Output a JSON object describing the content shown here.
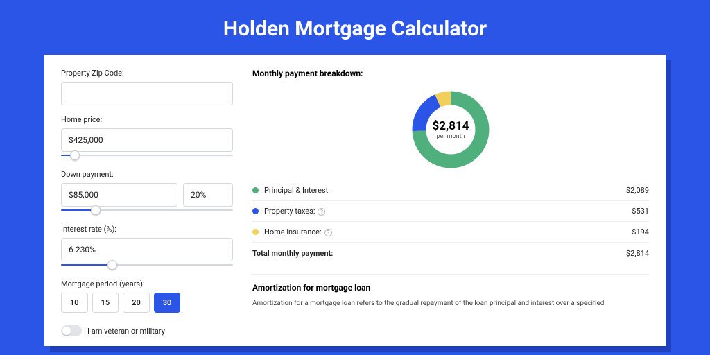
{
  "title": "Holden Mortgage Calculator",
  "form": {
    "zip": {
      "label": "Property Zip Code:",
      "value": ""
    },
    "homePrice": {
      "label": "Home price:",
      "value": "$425,000",
      "sliderPct": 8
    },
    "downPayment": {
      "label": "Down payment:",
      "amount": "$85,000",
      "pct": "20%",
      "sliderPct": 20
    },
    "interest": {
      "label": "Interest rate (%):",
      "value": "6.230%",
      "sliderPct": 30
    },
    "period": {
      "label": "Mortgage period (years):",
      "options": [
        "10",
        "15",
        "20",
        "30"
      ],
      "active": "30"
    },
    "veteran": {
      "label": "I am veteran or military",
      "checked": false
    }
  },
  "breakdown": {
    "title": "Monthly payment breakdown:",
    "centerValue": "$2,814",
    "centerSub": "per month",
    "items": [
      {
        "label": "Principal & Interest:",
        "value": "$2,089",
        "color": "#4faf7d",
        "info": false
      },
      {
        "label": "Property taxes:",
        "value": "$531",
        "color": "#2b55e6",
        "info": true
      },
      {
        "label": "Home insurance:",
        "value": "$194",
        "color": "#f2cf5b",
        "info": true
      }
    ],
    "totalLabel": "Total monthly payment:",
    "totalValue": "$2,814"
  },
  "chart_data": {
    "type": "pie",
    "title": "Monthly payment breakdown",
    "series": [
      {
        "name": "Principal & Interest",
        "value": 2089,
        "color": "#4faf7d"
      },
      {
        "name": "Property taxes",
        "value": 531,
        "color": "#2b55e6"
      },
      {
        "name": "Home insurance",
        "value": 194,
        "color": "#f2cf5b"
      }
    ],
    "total": 2814,
    "center_label": "$2,814 per month"
  },
  "amortization": {
    "title": "Amortization for mortgage loan",
    "text": "Amortization for a mortgage loan refers to the gradual repayment of the loan principal and interest over a specified"
  }
}
